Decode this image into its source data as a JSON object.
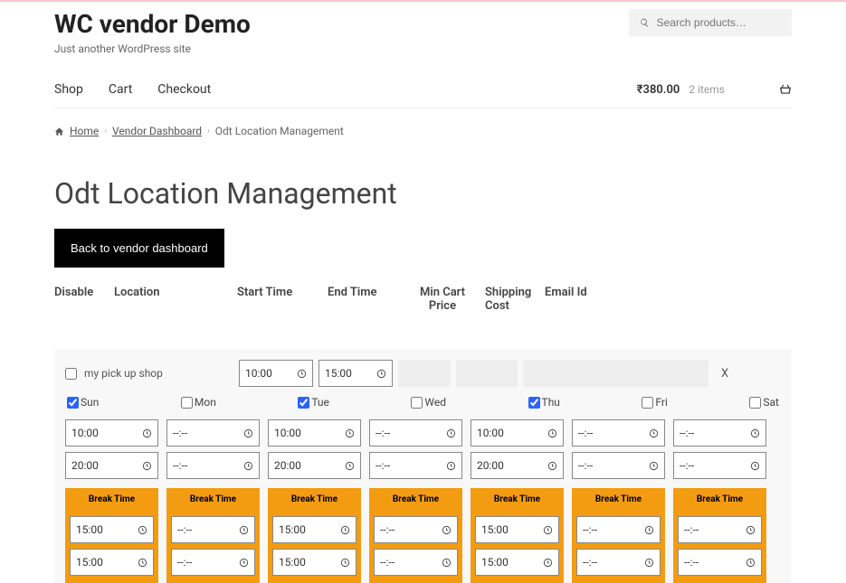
{
  "site": {
    "title": "WC vendor Demo",
    "tagline": "Just another WordPress site"
  },
  "search": {
    "placeholder": "Search products…"
  },
  "nav": {
    "shop": "Shop",
    "cart": "Cart",
    "checkout": "Checkout"
  },
  "cart_widget": {
    "amount": "₹380.00",
    "items": "2 items"
  },
  "breadcrumb": {
    "home": "Home",
    "vendor": "Vendor Dashboard",
    "current": "Odt Location Management"
  },
  "page": {
    "title": "Odt Location Management",
    "back_btn": "Back to vendor dashboard"
  },
  "columns": {
    "disable": "Disable",
    "location": "Location",
    "start": "Start Time",
    "end": "End Time",
    "price": "Min Cart Price",
    "shipping": "Shipping Cost",
    "email": "Email Id"
  },
  "row": {
    "location_name": "my pick up shop",
    "start": "10:00",
    "end": "15:00",
    "delete": "X"
  },
  "days": [
    {
      "label": "Sun",
      "checked": true
    },
    {
      "label": "Mon",
      "checked": false
    },
    {
      "label": "Tue",
      "checked": true
    },
    {
      "label": "Wed",
      "checked": false
    },
    {
      "label": "Thu",
      "checked": true
    },
    {
      "label": "Fri",
      "checked": false
    },
    {
      "label": "Sat",
      "checked": false
    }
  ],
  "break_label": "Break Time",
  "empty_time": "--:--",
  "schedule": [
    {
      "open": "10:00",
      "close": "20:00",
      "b1": "15:00",
      "b2": "15:00"
    },
    {
      "open": "--:--",
      "close": "--:--",
      "b1": "--:--",
      "b2": "--:--"
    },
    {
      "open": "10:00",
      "close": "20:00",
      "b1": "15:00",
      "b2": "15:00"
    },
    {
      "open": "--:--",
      "close": "--:--",
      "b1": "--:--",
      "b2": "--:--"
    },
    {
      "open": "10:00",
      "close": "20:00",
      "b1": "15:00",
      "b2": "15:00"
    },
    {
      "open": "--:--",
      "close": "--:--",
      "b1": "--:--",
      "b2": "--:--"
    },
    {
      "open": "--:--",
      "close": "--:--",
      "b1": "--:--",
      "b2": "--:--"
    }
  ]
}
